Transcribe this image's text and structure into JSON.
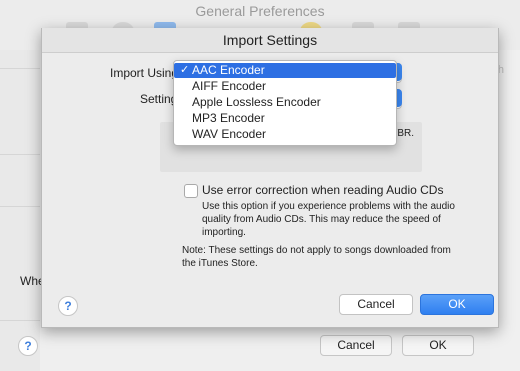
{
  "background": {
    "title": "General Preferences",
    "partial_left_label": "Whe",
    "partial_right_label": "ch",
    "help_label": "?",
    "cancel_label": "Cancel",
    "ok_label": "OK"
  },
  "sheet": {
    "title": "Import Settings",
    "import_using_label": "Import Using",
    "setting_label": "Setting",
    "details_text": "VBR.",
    "checkbox": {
      "label": "Use error correction when reading Audio CDs",
      "checked": false,
      "description": "Use this option if you experience problems with the audio quality from Audio CDs.  This may reduce the speed of importing."
    },
    "note": "Note: These settings do not apply to songs downloaded from the iTunes Store.",
    "help_label": "?",
    "cancel_label": "Cancel",
    "ok_label": "OK"
  },
  "dropdown": {
    "selected_index": 0,
    "check_mark": "✓",
    "items": [
      {
        "label": "AAC Encoder"
      },
      {
        "label": "AIFF Encoder"
      },
      {
        "label": "Apple Lossless Encoder"
      },
      {
        "label": "MP3 Encoder"
      },
      {
        "label": "WAV Encoder"
      }
    ]
  },
  "colors": {
    "accent": "#2d6fe3",
    "ok_button": "#3b87f0"
  }
}
